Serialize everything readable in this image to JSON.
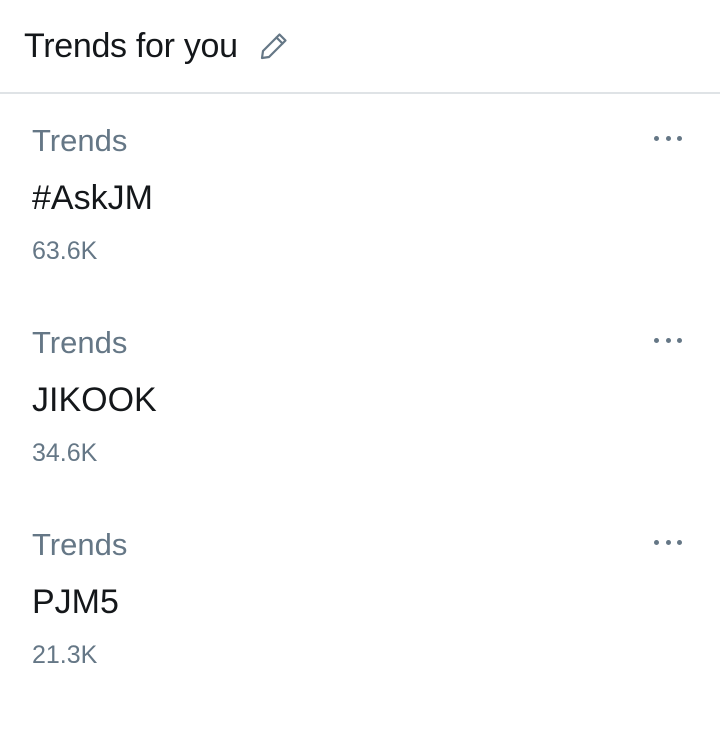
{
  "header": {
    "title": "Trends for you",
    "edit_icon": "pencil-icon"
  },
  "trends": [
    {
      "context": "Trends",
      "name": "#AskJM",
      "count": "63.6K",
      "more_icon": "more-dots-icon"
    },
    {
      "context": "Trends",
      "name": "JIKOOK",
      "count": "34.6K",
      "more_icon": "more-dots-icon"
    },
    {
      "context": "Trends",
      "name": "PJM5",
      "count": "21.3K",
      "more_icon": "more-dots-icon"
    }
  ],
  "colors": {
    "text_primary": "#14171a",
    "text_secondary": "#657786",
    "divider": "#dfe3e6",
    "background": "#ffffff"
  }
}
